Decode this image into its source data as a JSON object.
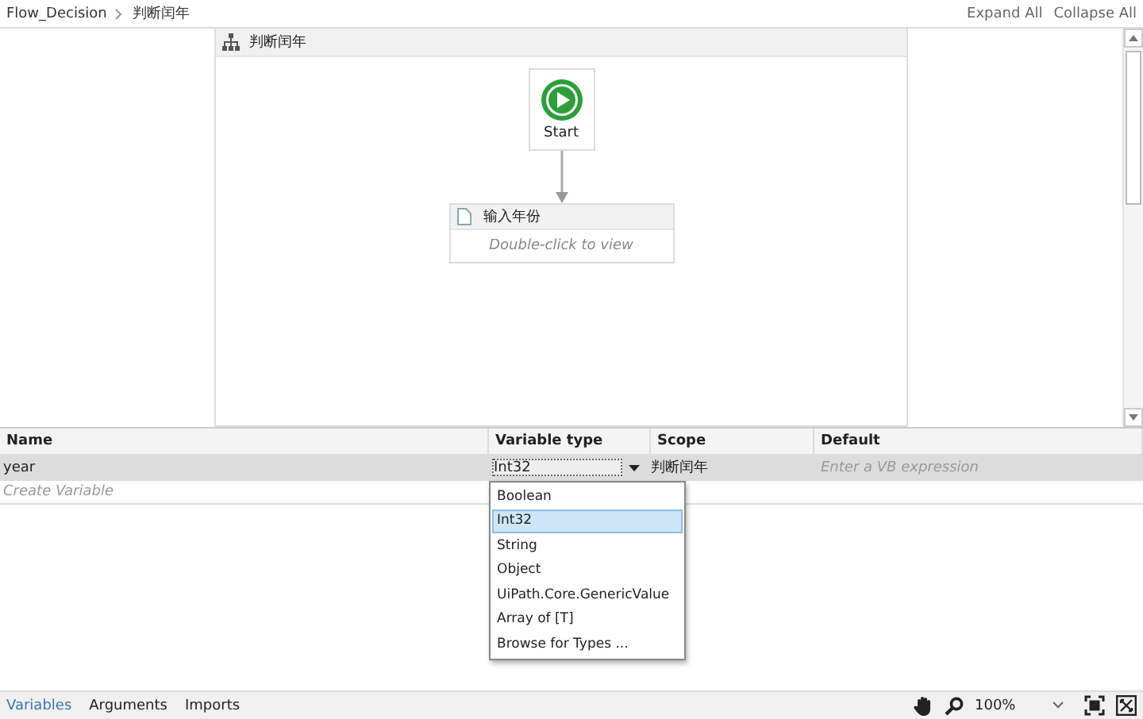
{
  "breadcrumb": [
    {
      "label": "Flow_Decision"
    },
    {
      "label": "判断闰年"
    }
  ],
  "header_actions": [
    "Expand All",
    "Collapse All"
  ],
  "flowchart": {
    "title": "判断闰年",
    "start": {
      "label": "Start"
    },
    "activities": [
      {
        "title": "输入年份",
        "hint": "Double-click to view"
      }
    ]
  },
  "variables": {
    "columns": [
      "Name",
      "Variable type",
      "Scope",
      "Default"
    ],
    "rows": [
      {
        "name": "year",
        "type": "Int32",
        "scope": "判断闰年",
        "default": {
          "placeholder": "Enter a VB expression"
        },
        "selected": true
      }
    ],
    "create": {
      "placeholder": "Create Variable"
    }
  },
  "type_dropdown": {
    "options": [
      {
        "label": "Boolean",
        "selected": false
      },
      {
        "label": "Int32",
        "selected": true
      },
      {
        "label": "String",
        "selected": false
      },
      {
        "label": "Object",
        "selected": false
      },
      {
        "label": "UiPath.Core.GenericValue",
        "selected": false
      },
      {
        "label": "Array of [T]",
        "selected": false
      },
      {
        "label": "Browse for Types ...",
        "selected": false
      }
    ]
  },
  "bottom_tabs": [
    {
      "label": "Variables",
      "selected": true
    },
    {
      "label": "Arguments",
      "selected": false
    },
    {
      "label": "Imports",
      "selected": false
    }
  ],
  "zoom": {
    "value": "100%"
  }
}
